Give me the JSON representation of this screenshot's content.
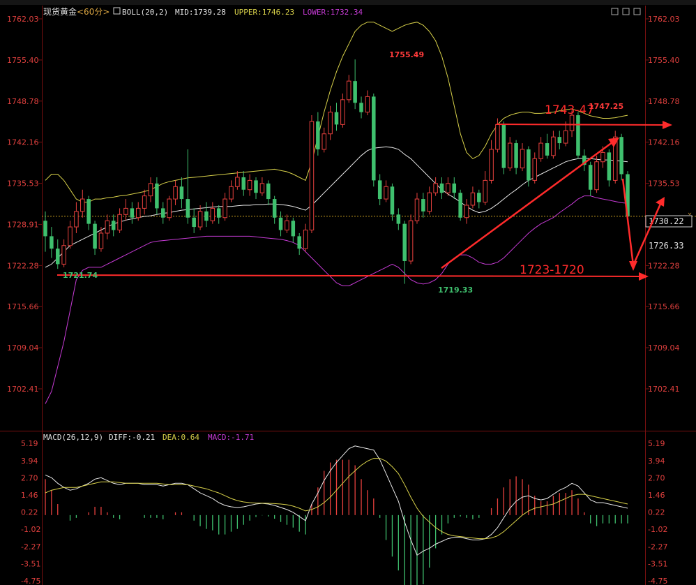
{
  "title_bar": {
    "instrument": "现货黄金",
    "period": "<60分>",
    "boll_label": "BOLL(20,2)",
    "mid": "MID:1739.28",
    "upper": "UPPER:1746.23",
    "lower": "LOWER:1732.34"
  },
  "macd_bar": {
    "label": "MACD(26,12,9)",
    "diff": "DIFF:-0.21",
    "dea": "DEA:0.64",
    "macd": "MACD:-1.71"
  },
  "price_axis": [
    "1762.03",
    "1755.40",
    "1748.78",
    "1742.16",
    "1735.53",
    "1728.91",
    "1722.28",
    "1715.66",
    "1709.04",
    "1702.41"
  ],
  "macd_axis": [
    "5.19",
    "3.94",
    "2.70",
    "1.46",
    "0.22",
    "-1.02",
    "-2.27",
    "-3.51",
    "-4.75"
  ],
  "current_price_tag": "1730.22",
  "marker_price_tag": "1726.33",
  "annotations": {
    "high_label": "1755.49",
    "low_label": "1719.33",
    "left_low_label": "1721.74",
    "right_high_label": "1747.25",
    "resistance_label": "1743-47",
    "support_label": "1723-1720"
  },
  "colors": {
    "background": "#000000",
    "up": "#e8413e",
    "down": "#3fc06e",
    "mid_line": "#e9e9e9",
    "upper_line": "#d9d24a",
    "lower_line": "#c73bd6",
    "axis_text": "#e0403e",
    "annotation": "#ff2b2b",
    "current_line": "#c8a020"
  },
  "chart_data": [
    {
      "type": "candlestick",
      "title": "现货黄金 <60分>",
      "ylim": [
        1699,
        1764
      ],
      "yticks": [
        1762.03,
        1755.4,
        1748.78,
        1742.16,
        1735.53,
        1728.91,
        1722.28,
        1715.66,
        1709.04,
        1702.41
      ],
      "current_price": 1730.22,
      "candles": [
        [
          1729.5,
          1727.0,
          1731.0,
          1724.5
        ],
        [
          1727.0,
          1725.0,
          1728.5,
          1723.5
        ],
        [
          1725.0,
          1722.5,
          1726.5,
          1721.74
        ],
        [
          1722.5,
          1725.5,
          1726.5,
          1722.0
        ],
        [
          1725.5,
          1728.5,
          1729.5,
          1725.0
        ],
        [
          1728.5,
          1731.0,
          1732.5,
          1727.5
        ],
        [
          1731.0,
          1733.0,
          1734.5,
          1730.0
        ],
        [
          1733.0,
          1729.0,
          1733.5,
          1728.0
        ],
        [
          1729.0,
          1725.0,
          1729.5,
          1724.0
        ],
        [
          1725.0,
          1727.5,
          1728.5,
          1724.5
        ],
        [
          1727.5,
          1729.5,
          1730.5,
          1726.5
        ],
        [
          1729.5,
          1728.0,
          1730.5,
          1727.0
        ],
        [
          1728.0,
          1730.5,
          1731.5,
          1727.5
        ],
        [
          1730.5,
          1731.5,
          1733.0,
          1729.5
        ],
        [
          1731.5,
          1730.0,
          1732.5,
          1729.0
        ],
        [
          1730.0,
          1731.5,
          1732.5,
          1729.5
        ],
        [
          1731.5,
          1733.5,
          1734.5,
          1730.5
        ],
        [
          1733.5,
          1735.5,
          1736.5,
          1732.5
        ],
        [
          1735.5,
          1731.5,
          1736.5,
          1730.5
        ],
        [
          1731.5,
          1730.0,
          1732.5,
          1729.0
        ],
        [
          1730.0,
          1733.0,
          1733.5,
          1729.5
        ],
        [
          1733.0,
          1735.0,
          1736.0,
          1732.0
        ],
        [
          1735.0,
          1733.0,
          1736.5,
          1731.5
        ],
        [
          1733.0,
          1730.0,
          1741.0,
          1729.0
        ],
        [
          1730.0,
          1728.5,
          1731.5,
          1727.5
        ],
        [
          1728.5,
          1731.0,
          1732.0,
          1728.0
        ],
        [
          1731.0,
          1729.5,
          1732.5,
          1728.5
        ],
        [
          1729.5,
          1731.5,
          1732.5,
          1729.0
        ],
        [
          1731.5,
          1730.0,
          1732.0,
          1729.0
        ],
        [
          1730.0,
          1733.0,
          1734.0,
          1729.5
        ],
        [
          1733.0,
          1735.0,
          1736.0,
          1732.5
        ],
        [
          1735.0,
          1736.5,
          1737.5,
          1734.5
        ],
        [
          1736.5,
          1734.5,
          1737.5,
          1733.5
        ],
        [
          1734.5,
          1736.0,
          1737.0,
          1733.5
        ],
        [
          1736.0,
          1734.0,
          1736.5,
          1733.0
        ],
        [
          1734.0,
          1735.5,
          1736.5,
          1733.5
        ],
        [
          1735.5,
          1733.0,
          1736.0,
          1732.0
        ],
        [
          1733.0,
          1730.0,
          1733.5,
          1729.0
        ],
        [
          1730.0,
          1728.0,
          1731.0,
          1727.0
        ],
        [
          1728.0,
          1729.5,
          1730.5,
          1727.5
        ],
        [
          1729.5,
          1727.0,
          1730.0,
          1726.0
        ],
        [
          1727.0,
          1725.0,
          1727.5,
          1724.0
        ],
        [
          1725.0,
          1728.0,
          1729.0,
          1724.5
        ],
        [
          1728.0,
          1745.5,
          1746.5,
          1727.5
        ],
        [
          1745.5,
          1741.0,
          1747.0,
          1740.0
        ],
        [
          1741.0,
          1743.5,
          1744.5,
          1740.5
        ],
        [
          1743.5,
          1747.0,
          1748.0,
          1742.5
        ],
        [
          1747.0,
          1745.0,
          1748.5,
          1744.0
        ],
        [
          1745.0,
          1749.0,
          1750.0,
          1744.5
        ],
        [
          1749.0,
          1752.0,
          1753.0,
          1748.5
        ],
        [
          1752.0,
          1748.5,
          1755.49,
          1747.5
        ],
        [
          1748.5,
          1747.0,
          1749.5,
          1746.0
        ],
        [
          1747.0,
          1749.5,
          1750.5,
          1746.5
        ],
        [
          1749.5,
          1736.0,
          1750.0,
          1735.0
        ],
        [
          1736.0,
          1733.0,
          1737.0,
          1732.0
        ],
        [
          1733.0,
          1735.0,
          1736.0,
          1732.5
        ],
        [
          1735.0,
          1730.5,
          1735.5,
          1729.5
        ],
        [
          1730.5,
          1729.0,
          1731.5,
          1728.0
        ],
        [
          1729.0,
          1723.0,
          1729.5,
          1719.33
        ],
        [
          1723.0,
          1729.5,
          1730.5,
          1722.5
        ],
        [
          1729.5,
          1733.0,
          1734.0,
          1729.0
        ],
        [
          1733.0,
          1731.0,
          1734.0,
          1730.0
        ],
        [
          1731.0,
          1734.0,
          1735.0,
          1730.5
        ],
        [
          1734.0,
          1735.5,
          1736.5,
          1733.5
        ],
        [
          1735.5,
          1734.0,
          1736.5,
          1733.0
        ],
        [
          1734.0,
          1735.5,
          1736.5,
          1733.5
        ],
        [
          1735.5,
          1734.0,
          1736.5,
          1733.0
        ],
        [
          1734.0,
          1730.0,
          1734.5,
          1729.5
        ],
        [
          1730.0,
          1732.0,
          1733.0,
          1729.0
        ],
        [
          1732.0,
          1734.0,
          1735.0,
          1731.5
        ],
        [
          1734.0,
          1732.5,
          1734.5,
          1731.5
        ],
        [
          1732.5,
          1736.0,
          1737.5,
          1732.0
        ],
        [
          1736.0,
          1741.0,
          1742.5,
          1735.5
        ],
        [
          1741.0,
          1745.0,
          1746.0,
          1740.5
        ],
        [
          1745.0,
          1738.0,
          1745.5,
          1737.0
        ],
        [
          1738.0,
          1742.0,
          1743.0,
          1737.5
        ],
        [
          1742.0,
          1738.0,
          1742.5,
          1737.0
        ],
        [
          1738.0,
          1741.0,
          1742.0,
          1737.5
        ],
        [
          1741.0,
          1736.0,
          1741.5,
          1735.0
        ],
        [
          1736.0,
          1739.5,
          1740.5,
          1735.5
        ],
        [
          1739.5,
          1742.0,
          1743.0,
          1739.0
        ],
        [
          1742.0,
          1740.0,
          1743.5,
          1739.5
        ],
        [
          1740.0,
          1743.0,
          1744.0,
          1739.5
        ],
        [
          1743.0,
          1742.0,
          1744.0,
          1741.0
        ],
        [
          1742.0,
          1744.0,
          1745.5,
          1741.5
        ],
        [
          1744.0,
          1746.5,
          1747.25,
          1743.0
        ],
        [
          1746.5,
          1740.0,
          1747.0,
          1739.5
        ],
        [
          1740.0,
          1738.5,
          1741.0,
          1737.5
        ],
        [
          1738.5,
          1734.5,
          1739.0,
          1733.5
        ],
        [
          1734.5,
          1739.0,
          1740.0,
          1734.0
        ],
        [
          1739.0,
          1740.5,
          1741.5,
          1738.0
        ],
        [
          1740.5,
          1736.0,
          1741.0,
          1735.0
        ],
        [
          1736.0,
          1743.0,
          1744.0,
          1735.5
        ],
        [
          1743.0,
          1737.0,
          1743.5,
          1736.0
        ],
        [
          1737.0,
          1730.2,
          1737.5,
          1729.8
        ]
      ],
      "boll_mid": [
        1722.0,
        1722.5,
        1723.5,
        1724.5,
        1725.5,
        1726.0,
        1726.5,
        1727.0,
        1727.5,
        1728.0,
        1728.5,
        1729.0,
        1729.3,
        1729.6,
        1729.8,
        1730.0,
        1730.2,
        1730.3,
        1730.5,
        1730.7,
        1730.8,
        1731.0,
        1731.2,
        1731.3,
        1731.4,
        1731.5,
        1731.6,
        1731.7,
        1731.8,
        1731.8,
        1731.8,
        1731.9,
        1732.0,
        1732.0,
        1732.1,
        1732.1,
        1732.2,
        1732.2,
        1732.1,
        1732.0,
        1731.8,
        1731.5,
        1731.2,
        1732.0,
        1733.0,
        1734.0,
        1735.0,
        1736.0,
        1737.0,
        1738.0,
        1739.0,
        1740.0,
        1740.8,
        1741.2,
        1741.3,
        1741.4,
        1741.3,
        1741.0,
        1740.2,
        1739.5,
        1738.5,
        1737.5,
        1736.5,
        1735.5,
        1734.5,
        1733.8,
        1733.2,
        1732.5,
        1731.8,
        1731.2,
        1730.8,
        1731.0,
        1731.5,
        1732.2,
        1733.0,
        1733.8,
        1734.5,
        1735.3,
        1736.0,
        1736.5,
        1737.0,
        1737.5,
        1738.0,
        1738.5,
        1739.0,
        1739.3,
        1739.5,
        1739.6,
        1739.5,
        1739.4,
        1739.3,
        1739.3,
        1739.2,
        1739.1,
        1739.0
      ],
      "boll_upper": [
        1736.0,
        1737.0,
        1737.0,
        1736.0,
        1734.5,
        1733.0,
        1732.5,
        1732.5,
        1733.0,
        1733.0,
        1733.2,
        1733.3,
        1733.5,
        1733.6,
        1733.8,
        1734.0,
        1734.2,
        1734.5,
        1735.0,
        1735.5,
        1735.8,
        1736.0,
        1736.2,
        1736.4,
        1736.5,
        1736.6,
        1736.7,
        1736.8,
        1736.9,
        1737.0,
        1737.1,
        1737.2,
        1737.3,
        1737.4,
        1737.5,
        1737.6,
        1737.7,
        1737.8,
        1737.6,
        1737.4,
        1737.0,
        1736.5,
        1736.0,
        1739.0,
        1743.0,
        1747.0,
        1750.5,
        1753.5,
        1756.0,
        1758.0,
        1760.0,
        1761.0,
        1761.5,
        1761.5,
        1761.0,
        1760.5,
        1760.0,
        1760.5,
        1761.0,
        1761.3,
        1761.5,
        1761.0,
        1760.0,
        1758.5,
        1756.0,
        1752.5,
        1748.0,
        1743.5,
        1740.5,
        1739.5,
        1740.0,
        1741.5,
        1743.5,
        1745.0,
        1746.0,
        1746.5,
        1746.8,
        1747.0,
        1747.0,
        1746.8,
        1746.8,
        1746.9,
        1747.0,
        1747.2,
        1747.4,
        1747.5,
        1747.2,
        1746.8,
        1746.4,
        1746.2,
        1746.0,
        1746.0,
        1746.1,
        1746.3,
        1746.5
      ],
      "boll_lower": [
        1700.0,
        1702.0,
        1706.0,
        1710.0,
        1715.0,
        1720.0,
        1721.5,
        1722.0,
        1722.0,
        1722.0,
        1722.5,
        1723.0,
        1723.5,
        1724.0,
        1724.5,
        1725.0,
        1725.5,
        1726.0,
        1726.2,
        1726.3,
        1726.4,
        1726.5,
        1726.6,
        1726.7,
        1726.8,
        1726.9,
        1727.0,
        1727.0,
        1727.0,
        1727.0,
        1727.0,
        1727.0,
        1727.0,
        1727.0,
        1726.9,
        1726.8,
        1726.7,
        1726.6,
        1726.5,
        1726.3,
        1726.0,
        1725.5,
        1724.5,
        1723.5,
        1722.5,
        1721.5,
        1720.5,
        1719.5,
        1719.0,
        1719.0,
        1719.5,
        1720.0,
        1720.5,
        1721.0,
        1721.5,
        1722.0,
        1722.5,
        1722.0,
        1721.0,
        1720.0,
        1719.5,
        1719.3,
        1719.5,
        1720.0,
        1721.0,
        1722.5,
        1723.5,
        1724.0,
        1724.0,
        1723.5,
        1722.8,
        1722.5,
        1722.5,
        1722.8,
        1723.5,
        1724.5,
        1725.5,
        1726.5,
        1727.5,
        1728.3,
        1729.0,
        1729.5,
        1730.0,
        1730.8,
        1731.5,
        1732.2,
        1733.0,
        1733.5,
        1733.5,
        1733.2,
        1733.0,
        1732.8,
        1732.6,
        1732.4,
        1732.3
      ]
    },
    {
      "type": "macd",
      "title": "MACD(26,12,9)",
      "ylim": [
        -4.75,
        5.19
      ],
      "yticks": [
        5.19,
        3.94,
        2.7,
        1.46,
        0.22,
        -1.02,
        -2.27,
        -3.51,
        -4.75
      ],
      "diff": [
        2.9,
        2.7,
        2.3,
        2.0,
        1.8,
        1.9,
        2.1,
        2.3,
        2.6,
        2.7,
        2.5,
        2.3,
        2.2,
        2.3,
        2.3,
        2.3,
        2.2,
        2.2,
        2.2,
        2.1,
        2.2,
        2.3,
        2.3,
        2.2,
        1.9,
        1.6,
        1.4,
        1.2,
        0.9,
        0.7,
        0.6,
        0.55,
        0.6,
        0.7,
        0.8,
        0.85,
        0.8,
        0.7,
        0.55,
        0.4,
        0.2,
        -0.1,
        -0.4,
        0.8,
        1.6,
        2.5,
        3.2,
        3.8,
        4.3,
        4.8,
        5.0,
        4.9,
        4.8,
        4.7,
        4.0,
        3.0,
        2.0,
        1.0,
        -0.5,
        -1.8,
        -2.9,
        -2.6,
        -2.4,
        -2.1,
        -1.9,
        -1.7,
        -1.6,
        -1.6,
        -1.7,
        -1.8,
        -1.8,
        -1.7,
        -1.4,
        -0.9,
        -0.2,
        0.5,
        1.0,
        1.3,
        1.4,
        1.2,
        1.1,
        1.2,
        1.5,
        1.8,
        2.0,
        2.3,
        2.1,
        1.6,
        1.1,
        0.9,
        0.9,
        0.8,
        0.7,
        0.6,
        0.5
      ],
      "dea": [
        1.6,
        1.8,
        1.9,
        2.0,
        2.0,
        2.0,
        2.1,
        2.2,
        2.3,
        2.4,
        2.4,
        2.4,
        2.35,
        2.3,
        2.3,
        2.3,
        2.3,
        2.3,
        2.3,
        2.25,
        2.2,
        2.2,
        2.2,
        2.2,
        2.1,
        2.0,
        1.9,
        1.75,
        1.6,
        1.4,
        1.2,
        1.05,
        0.95,
        0.9,
        0.87,
        0.86,
        0.85,
        0.83,
        0.8,
        0.75,
        0.65,
        0.5,
        0.3,
        0.4,
        0.6,
        0.9,
        1.3,
        1.8,
        2.3,
        2.8,
        3.2,
        3.6,
        3.9,
        4.1,
        4.1,
        3.9,
        3.5,
        3.0,
        2.2,
        1.3,
        0.5,
        -0.1,
        -0.5,
        -0.9,
        -1.2,
        -1.4,
        -1.5,
        -1.55,
        -1.6,
        -1.65,
        -1.7,
        -1.7,
        -1.65,
        -1.5,
        -1.2,
        -0.8,
        -0.4,
        0.0,
        0.3,
        0.5,
        0.6,
        0.7,
        0.8,
        1.0,
        1.2,
        1.4,
        1.5,
        1.5,
        1.4,
        1.3,
        1.2,
        1.1,
        1.0,
        0.9,
        0.8
      ]
    }
  ]
}
